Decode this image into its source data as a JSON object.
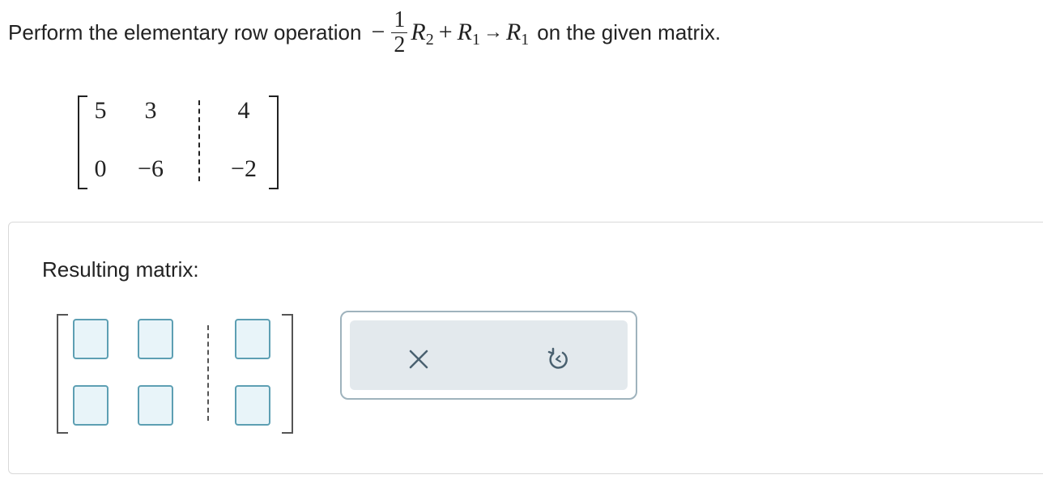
{
  "question": {
    "prefix": "Perform the elementary row operation",
    "frac_num": "1",
    "frac_den": "2",
    "minus": "−",
    "r": "R",
    "sub2": "2",
    "sub1": "1",
    "plus": "+",
    "arrow": "→",
    "suffix": "on the given matrix."
  },
  "given_matrix": {
    "rows": [
      [
        "5",
        "3",
        "4"
      ],
      [
        "0",
        "−6",
        "−2"
      ]
    ]
  },
  "answer": {
    "label": "Resulting matrix:",
    "rows": [
      [
        "",
        "",
        ""
      ],
      [
        "",
        "",
        ""
      ]
    ]
  },
  "tools": {
    "clear_icon": "x-icon",
    "reset_icon": "undo-icon"
  },
  "colors": {
    "input_border": "#5d9fb3",
    "input_fill": "#e8f4f9",
    "tool_fill": "#e3e9ed",
    "icon": "#4a6170"
  }
}
